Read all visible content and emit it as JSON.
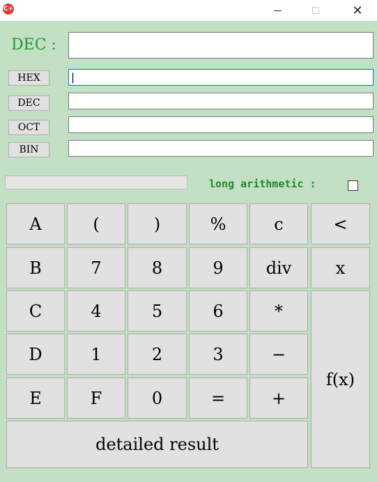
{
  "window": {
    "app_icon": "C+",
    "minimize_glyph": "",
    "close_glyph": "✕"
  },
  "display": {
    "label": "DEC :",
    "value": ""
  },
  "bases": [
    {
      "label": "HEX",
      "value": "|"
    },
    {
      "label": "DEC",
      "value": ""
    },
    {
      "label": "OCT",
      "value": ""
    },
    {
      "label": "BIN",
      "value": ""
    }
  ],
  "options": {
    "long_arithmetic_label": "long arithmetic :",
    "long_arithmetic_checked": false
  },
  "keypad": {
    "A": "A",
    "open_paren": "(",
    "close_paren": ")",
    "percent": "%",
    "clear": "c",
    "backspace": "<",
    "B": "B",
    "seven": "7",
    "eight": "8",
    "nine": "9",
    "div": "div",
    "times": "x",
    "C": "C",
    "four": "4",
    "five": "5",
    "six": "6",
    "multiply": "*",
    "D": "D",
    "one": "1",
    "two": "2",
    "three": "3",
    "minus": "−",
    "E": "E",
    "F": "F",
    "zero": "0",
    "equals": "=",
    "plus": "+",
    "fx": "f(x)",
    "detailed_result": "detailed result"
  }
}
